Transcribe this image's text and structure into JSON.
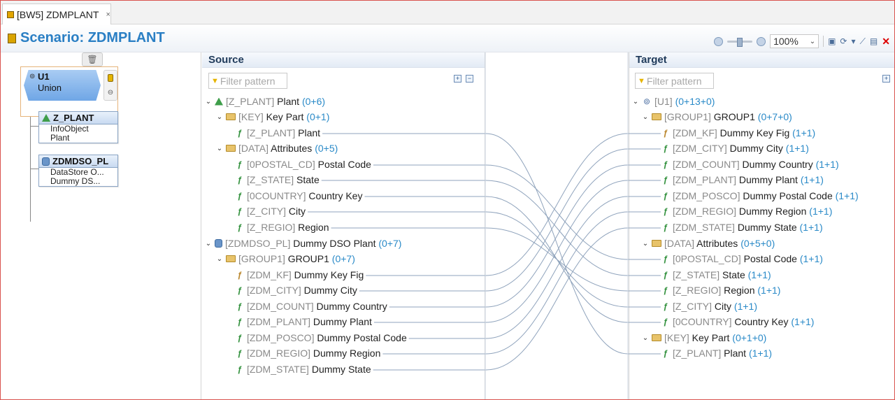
{
  "tab": {
    "title": "[BW5] ZDMPLANT",
    "close": "×"
  },
  "header": {
    "title": "Scenario: ZDMPLANT",
    "zoom": "100%"
  },
  "diagram": {
    "union": {
      "name": "U1",
      "type": "Union"
    },
    "children": [
      {
        "name": "Z_PLANT",
        "line1": "InfoObject",
        "line2": "Plant"
      },
      {
        "name": "ZDMDSO_PL",
        "line1": "DataStore O...",
        "line2": "Dummy DS..."
      }
    ]
  },
  "source": {
    "label": "Source",
    "filter_placeholder": "Filter pattern",
    "rows": [
      {
        "tech": "[Z_PLANT]",
        "name": " Plant",
        "count": " (0+6)"
      },
      {
        "tech": "[KEY]",
        "name": " Key Part",
        "count": " (0+1)"
      },
      {
        "tech": "[Z_PLANT]",
        "name": " Plant",
        "count": ""
      },
      {
        "tech": "[DATA]",
        "name": " Attributes",
        "count": " (0+5)"
      },
      {
        "tech": "[0POSTAL_CD]",
        "name": " Postal Code",
        "count": ""
      },
      {
        "tech": "[Z_STATE]",
        "name": " State",
        "count": ""
      },
      {
        "tech": "[0COUNTRY]",
        "name": " Country Key",
        "count": ""
      },
      {
        "tech": "[Z_CITY]",
        "name": " City",
        "count": ""
      },
      {
        "tech": "[Z_REGIO]",
        "name": " Region",
        "count": ""
      },
      {
        "tech": "[ZDMDSO_PL]",
        "name": " Dummy DSO Plant",
        "count": " (0+7)"
      },
      {
        "tech": "[GROUP1]",
        "name": " GROUP1",
        "count": " (0+7)"
      },
      {
        "tech": "[ZDM_KF]",
        "name": " Dummy Key Fig",
        "count": ""
      },
      {
        "tech": "[ZDM_CITY]",
        "name": " Dummy City",
        "count": ""
      },
      {
        "tech": "[ZDM_COUNT]",
        "name": " Dummy Country",
        "count": ""
      },
      {
        "tech": "[ZDM_PLANT]",
        "name": " Dummy Plant",
        "count": ""
      },
      {
        "tech": "[ZDM_POSCO]",
        "name": " Dummy Postal Code",
        "count": ""
      },
      {
        "tech": "[ZDM_REGIO]",
        "name": " Dummy Region",
        "count": ""
      },
      {
        "tech": "[ZDM_STATE]",
        "name": " Dummy State",
        "count": ""
      }
    ]
  },
  "target": {
    "label": "Target",
    "filter_placeholder": "Filter pattern",
    "rows": [
      {
        "tech": "[U1]",
        "name": "",
        "count": " (0+13+0)"
      },
      {
        "tech": "[GROUP1]",
        "name": " GROUP1",
        "count": " (0+7+0)"
      },
      {
        "tech": "[ZDM_KF]",
        "name": " Dummy Key Fig",
        "count": " (1+1)"
      },
      {
        "tech": "[ZDM_CITY]",
        "name": " Dummy City",
        "count": " (1+1)"
      },
      {
        "tech": "[ZDM_COUNT]",
        "name": " Dummy Country",
        "count": " (1+1)"
      },
      {
        "tech": "[ZDM_PLANT]",
        "name": " Dummy Plant",
        "count": " (1+1)"
      },
      {
        "tech": "[ZDM_POSCO]",
        "name": " Dummy Postal Code",
        "count": " (1+1)"
      },
      {
        "tech": "[ZDM_REGIO]",
        "name": " Dummy Region",
        "count": " (1+1)"
      },
      {
        "tech": "[ZDM_STATE]",
        "name": " Dummy State",
        "count": " (1+1)"
      },
      {
        "tech": "[DATA]",
        "name": " Attributes",
        "count": " (0+5+0)"
      },
      {
        "tech": "[0POSTAL_CD]",
        "name": " Postal Code",
        "count": " (1+1)"
      },
      {
        "tech": "[Z_STATE]",
        "name": " State",
        "count": " (1+1)"
      },
      {
        "tech": "[Z_REGIO]",
        "name": " Region",
        "count": " (1+1)"
      },
      {
        "tech": "[Z_CITY]",
        "name": " City",
        "count": " (1+1)"
      },
      {
        "tech": "[0COUNTRY]",
        "name": " Country Key",
        "count": " (1+1)"
      },
      {
        "tech": "[KEY]",
        "name": " Key Part",
        "count": " (0+1+0)"
      },
      {
        "tech": "[Z_PLANT]",
        "name": " Plant",
        "count": " (1+1)"
      }
    ]
  },
  "mappings": [
    {
      "from": 2,
      "to": 16
    },
    {
      "from": 4,
      "to": 10
    },
    {
      "from": 5,
      "to": 11
    },
    {
      "from": 6,
      "to": 14
    },
    {
      "from": 7,
      "to": 13
    },
    {
      "from": 8,
      "to": 12
    },
    {
      "from": 11,
      "to": 2
    },
    {
      "from": 12,
      "to": 3
    },
    {
      "from": 13,
      "to": 4
    },
    {
      "from": 14,
      "to": 5
    },
    {
      "from": 15,
      "to": 6
    },
    {
      "from": 16,
      "to": 7
    },
    {
      "from": 17,
      "to": 8
    }
  ],
  "colors": {
    "accent": "#2a7fc4",
    "count": "#2a8ac8",
    "line": "#8fa3bc"
  }
}
